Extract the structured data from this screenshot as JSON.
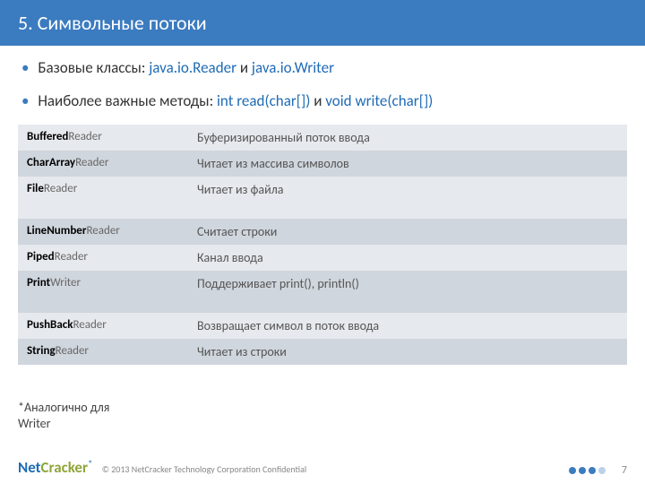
{
  "header": {
    "title": "5. Символьные потоки"
  },
  "bullets": {
    "b1": {
      "prefix": "Базовые классы: ",
      "blue1": "java.io.Reader",
      "mid": " и ",
      "blue2": "java.io.Writer"
    },
    "b2": {
      "prefix": "Наиболее важные методы: ",
      "blue1": "int read(char[])",
      "mid": " и ",
      "blue2": "void write(char[])"
    }
  },
  "table": {
    "rows": [
      {
        "bold": "Buffered",
        "suffix": "Reader",
        "desc": "Буферизированный поток ввода"
      },
      {
        "bold": "CharArray",
        "suffix": "Reader",
        "desc": "Читает из массива символов"
      },
      {
        "bold": "File",
        "suffix": "Reader",
        "desc": "Читает из файла"
      },
      {
        "bold": "LineNumber",
        "suffix": "Reader",
        "desc": "Считает строки"
      },
      {
        "bold": "Piped",
        "suffix": "Reader",
        "desc": "Канал ввода"
      },
      {
        "bold": "Print",
        "suffix": "Writer",
        "desc": "Поддерживает print(), println()"
      },
      {
        "bold": "PushBack",
        "suffix": "Reader",
        "desc": "Возвращает символ в поток ввода"
      },
      {
        "bold": "String",
        "suffix": "Reader",
        "desc": "Читает из строки"
      }
    ]
  },
  "footnote": {
    "line1": "*Аналогично для",
    "line2": "Writer"
  },
  "footer": {
    "logo_net": "Net",
    "logo_cracker": "Cracker",
    "logo_r": "®",
    "copyright": "© 2013 NetCracker Technology Corporation Confidential",
    "page": "7"
  }
}
